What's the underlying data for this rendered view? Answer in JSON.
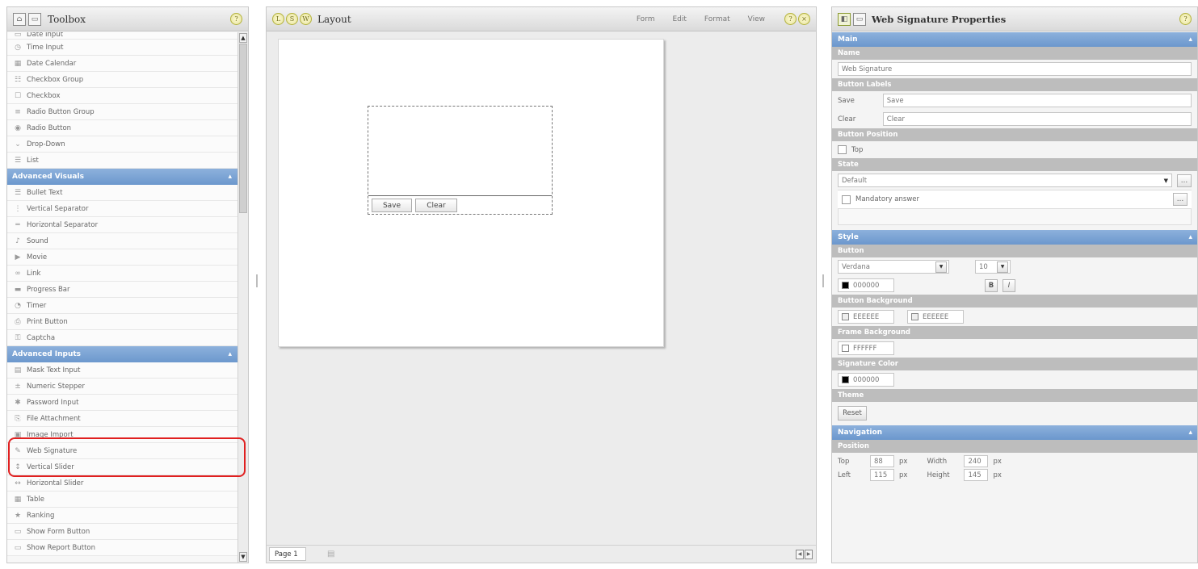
{
  "toolbox": {
    "title": "Toolbox",
    "items_top_partial": "Date Input",
    "items_basic": [
      {
        "icon": "time-input-icon",
        "label": "Time Input"
      },
      {
        "icon": "date-calendar-icon",
        "label": "Date Calendar"
      },
      {
        "icon": "checkbox-group-icon",
        "label": "Checkbox Group"
      },
      {
        "icon": "checkbox-icon",
        "label": "Checkbox"
      },
      {
        "icon": "radio-button-group-icon",
        "label": "Radio Button Group"
      },
      {
        "icon": "radio-button-icon",
        "label": "Radio Button"
      },
      {
        "icon": "drop-down-icon",
        "label": "Drop-Down"
      },
      {
        "icon": "list-icon",
        "label": "List"
      }
    ],
    "cat_visuals": "Advanced Visuals",
    "items_visuals": [
      {
        "icon": "bullet-text-icon",
        "label": "Bullet Text"
      },
      {
        "icon": "vertical-separator-icon",
        "label": "Vertical Separator"
      },
      {
        "icon": "horizontal-separator-icon",
        "label": "Horizontal Separator"
      },
      {
        "icon": "sound-icon",
        "label": "Sound"
      },
      {
        "icon": "movie-icon",
        "label": "Movie"
      },
      {
        "icon": "link-icon",
        "label": "Link"
      },
      {
        "icon": "progress-bar-icon",
        "label": "Progress Bar"
      },
      {
        "icon": "timer-icon",
        "label": "Timer"
      },
      {
        "icon": "print-button-icon",
        "label": "Print Button"
      },
      {
        "icon": "captcha-icon",
        "label": "Captcha"
      }
    ],
    "cat_inputs": "Advanced Inputs",
    "items_inputs": [
      {
        "icon": "mask-text-input-icon",
        "label": "Mask Text Input"
      },
      {
        "icon": "numeric-stepper-icon",
        "label": "Numeric Stepper"
      },
      {
        "icon": "password-input-icon",
        "label": "Password Input"
      },
      {
        "icon": "file-attachment-icon",
        "label": "File Attachment"
      },
      {
        "icon": "image-import-icon",
        "label": "Image Import"
      },
      {
        "icon": "web-signature-icon",
        "label": "Web Signature"
      },
      {
        "icon": "vertical-slider-icon",
        "label": "Vertical Slider"
      },
      {
        "icon": "horizontal-slider-icon",
        "label": "Horizontal Slider"
      },
      {
        "icon": "table-icon",
        "label": "Table"
      },
      {
        "icon": "ranking-icon",
        "label": "Ranking"
      },
      {
        "icon": "show-form-button-icon",
        "label": "Show Form Button"
      },
      {
        "icon": "show-report-button-icon",
        "label": "Show Report Button"
      }
    ]
  },
  "layout": {
    "title": "Layout",
    "menus": [
      "Form",
      "Edit",
      "Format",
      "View"
    ],
    "canvas": {
      "save_label": "Save",
      "clear_label": "Clear"
    },
    "page_tab": "Page 1"
  },
  "props": {
    "title": "Web Signature Properties",
    "main_section": "Main",
    "name_label": "Name",
    "name_value": "Web Signature",
    "button_labels_head": "Button Labels",
    "save_field_label": "Save",
    "save_field_value": "Save",
    "clear_field_label": "Clear",
    "clear_field_value": "Clear",
    "button_position_head": "Button Position",
    "top_checkbox_label": "Top",
    "state_head": "State",
    "state_value": "Default",
    "mandatory_label": "Mandatory answer",
    "style_section": "Style",
    "button_head": "Button",
    "font_value": "Verdana",
    "font_size_value": "10",
    "button_color": "000000",
    "bold_label": "B",
    "italic_label": "I",
    "button_background_head": "Button Background",
    "bg_color_1": "EEEEEE",
    "bg_color_2": "EEEEEE",
    "frame_background_head": "Frame Background",
    "frame_color": "FFFFFF",
    "signature_color_head": "Signature Color",
    "signature_color": "000000",
    "theme_head": "Theme",
    "reset_label": "Reset",
    "navigation_section": "Navigation",
    "position_head": "Position",
    "top_label": "Top",
    "top_value": "88",
    "left_label": "Left",
    "left_value": "115",
    "width_label": "Width",
    "width_value": "240",
    "height_label": "Height",
    "height_value": "145",
    "unit": "px"
  },
  "colors": {
    "accent_blue": "#7aa3d6",
    "highlight_red": "#e02020"
  }
}
